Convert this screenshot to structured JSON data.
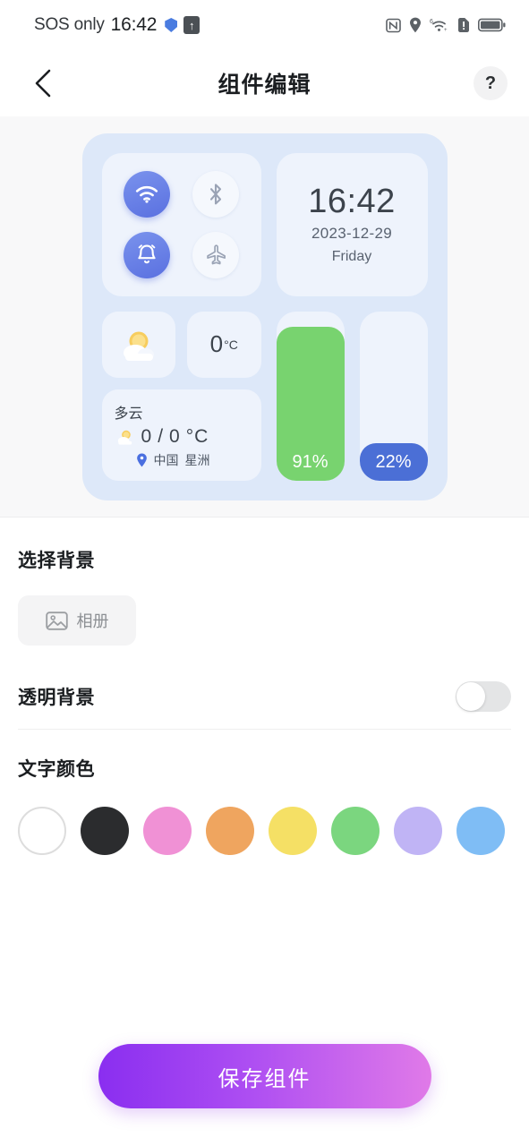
{
  "status_bar": {
    "carrier": "SOS only",
    "time": "16:42",
    "icons_left": [
      "shield-icon",
      "upload-arrow-icon"
    ],
    "icons_right": [
      "nfc-icon",
      "location-icon",
      "wifi-6-icon",
      "sim-alert-icon",
      "battery-icon"
    ]
  },
  "nav": {
    "back_icon": "chevron-left-icon",
    "title": "组件编辑",
    "help_label": "?"
  },
  "widget_preview": {
    "toggles": [
      {
        "name": "wifi",
        "icon": "wifi-icon",
        "active": true
      },
      {
        "name": "bluetooth",
        "icon": "bluetooth-icon",
        "active": false
      },
      {
        "name": "alarm",
        "icon": "bell-icon",
        "active": true
      },
      {
        "name": "airplane",
        "icon": "airplane-icon",
        "active": false
      }
    ],
    "clock": {
      "time": "16:42",
      "date": "2023-12-29",
      "weekday": "Friday"
    },
    "weather": {
      "icon": "sun-behind-cloud-icon",
      "temperature": "0",
      "temperature_unit": "°C",
      "condition": "多云",
      "range_low": "0",
      "range_sep": "/",
      "range_high": "0",
      "range_unit": "°C",
      "location_icon": "location-pin-icon",
      "country": "中国",
      "city": "星洲"
    },
    "bars": [
      {
        "name": "battery",
        "value": 91,
        "label": "91%",
        "color": "#78d36f"
      },
      {
        "name": "storage",
        "value": 22,
        "label": "22%",
        "color": "#4b6fd6"
      }
    ]
  },
  "settings": {
    "background_section_title": "选择背景",
    "album_button_label": "相册",
    "album_icon": "image-icon",
    "transparent_section_title": "透明背景",
    "transparent_enabled": false,
    "text_color_section_title": "文字颜色",
    "text_colors": [
      {
        "name": "white",
        "hex": "#ffffff",
        "selected": true
      },
      {
        "name": "black",
        "hex": "#2b2c2e",
        "selected": false
      },
      {
        "name": "pink",
        "hex": "#f091d5",
        "selected": false
      },
      {
        "name": "orange",
        "hex": "#efa55f",
        "selected": false
      },
      {
        "name": "yellow",
        "hex": "#f5e065",
        "selected": false
      },
      {
        "name": "green",
        "hex": "#7bd67f",
        "selected": false
      },
      {
        "name": "lavender",
        "hex": "#c0b4f5",
        "selected": false
      },
      {
        "name": "sky-blue",
        "hex": "#7fbdf5",
        "selected": false
      },
      {
        "name": "violet",
        "hex": "#a64df0",
        "selected": false
      }
    ]
  },
  "save_button": {
    "label": "保存组件"
  }
}
